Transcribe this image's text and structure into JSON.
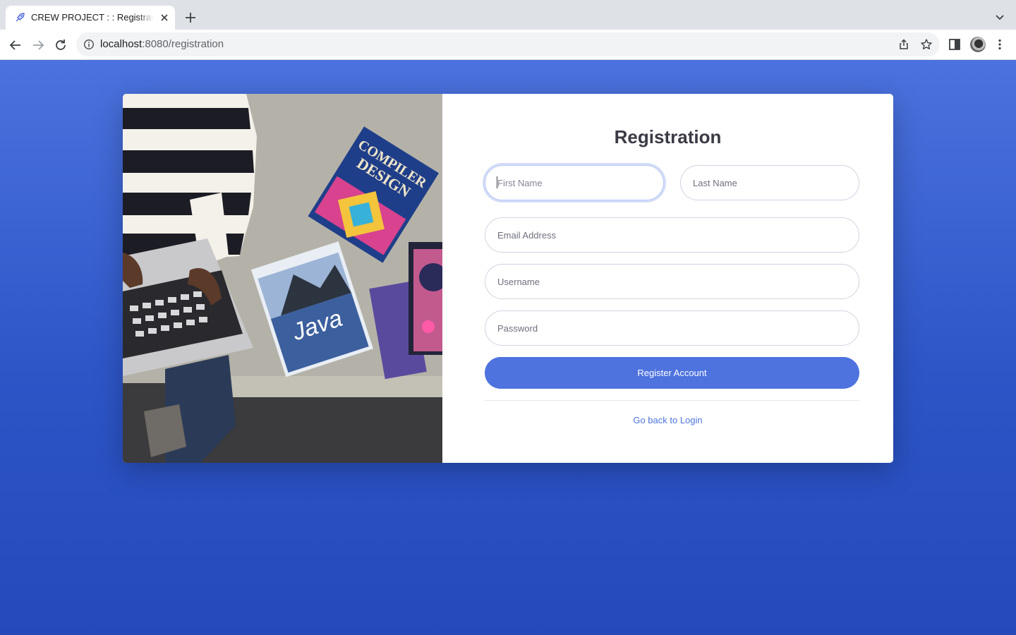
{
  "browser": {
    "tab_title": "CREW PROJECT : : Registration",
    "url_host": "localhost",
    "url_path": ":8080/registration"
  },
  "photo": {
    "books": [
      {
        "title_line1": "COMPILER",
        "title_line2": "DESIGN"
      },
      {
        "title": "Java"
      }
    ]
  },
  "form": {
    "title": "Registration",
    "first_name_placeholder": "First Name",
    "last_name_placeholder": "Last Name",
    "email_placeholder": "Email Address",
    "username_placeholder": "Username",
    "password_placeholder": "Password",
    "register_label": "Register Account",
    "login_link": "Go back to Login"
  },
  "colors": {
    "background": "#3a5fd0",
    "primary": "#4e73df",
    "card": "#ffffff"
  }
}
